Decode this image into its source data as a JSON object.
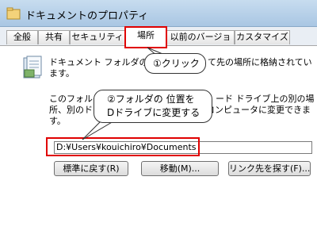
{
  "window": {
    "title": "ドキュメントのプロパティ"
  },
  "tabs": [
    {
      "label": "全般"
    },
    {
      "label": "共有"
    },
    {
      "label": "セキュリティ"
    },
    {
      "label": "場所"
    },
    {
      "label": "以前のバージョン"
    },
    {
      "label": "カスタマイズ"
    }
  ],
  "location": {
    "desc_line1": "ドキュメント フォルダのファ",
    "desc_line1_tail": "て先の場所に格納されてい",
    "desc_line2": "ます。",
    "move_line1": "このフォルダ",
    "move_line1_tail": "ード ドライブ上の別の場",
    "move_line2": "所、別のドラ",
    "move_line2_tail": "コンピュータに変更できま",
    "move_line3": "す。",
    "path_value": "D:¥Users¥kouichiro¥Documents",
    "restore_button": "標準に戻す(R)",
    "move_button": "移動(M)...",
    "find_target_button": "リンク先を探す(F)..."
  },
  "callouts": {
    "step1": "①クリック",
    "step2_line1": "②フォルダの 位置を",
    "step2_line2": "Dドライブに変更する"
  },
  "colors": {
    "highlight": "#e00000",
    "titlebar": "#b9d2ea"
  }
}
